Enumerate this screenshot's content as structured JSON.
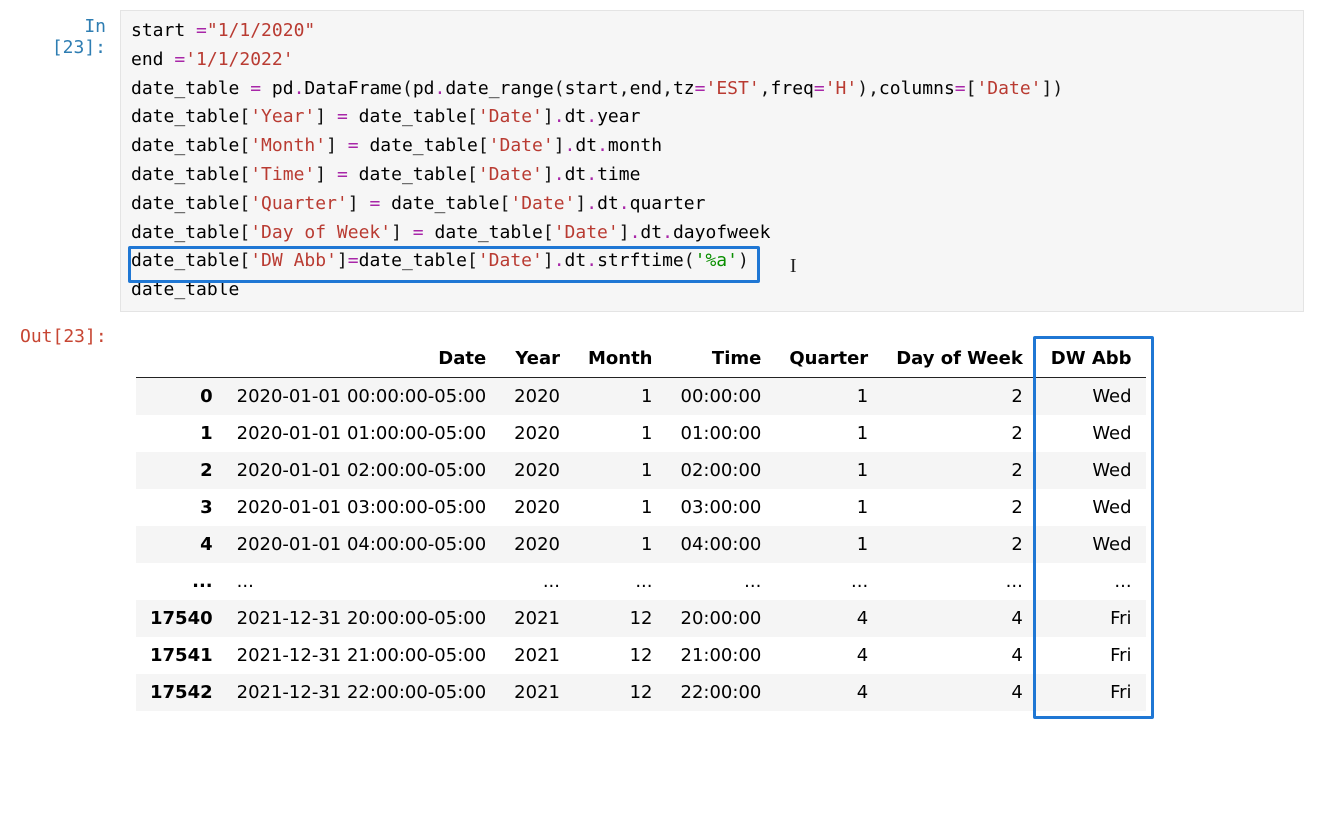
{
  "input_prompt": "In [23]:",
  "output_prompt": "Out[23]:",
  "code_lines": [
    [
      {
        "t": "start ",
        "c": ""
      },
      {
        "t": "=",
        "c": "tok-op"
      },
      {
        "t": "\"1/1/2020\"",
        "c": "tok-str"
      }
    ],
    [
      {
        "t": "end ",
        "c": ""
      },
      {
        "t": "=",
        "c": "tok-op"
      },
      {
        "t": "'1/1/2022'",
        "c": "tok-str"
      }
    ],
    [
      {
        "t": "date_table ",
        "c": ""
      },
      {
        "t": "=",
        "c": "tok-op"
      },
      {
        "t": " pd",
        "c": ""
      },
      {
        "t": ".",
        "c": "tok-op"
      },
      {
        "t": "DataFrame",
        "c": ""
      },
      {
        "t": "(",
        "c": "tok-paren"
      },
      {
        "t": "pd",
        "c": ""
      },
      {
        "t": ".",
        "c": "tok-op"
      },
      {
        "t": "date_range",
        "c": ""
      },
      {
        "t": "(",
        "c": "tok-paren"
      },
      {
        "t": "start",
        "c": ""
      },
      {
        "t": ",",
        "c": "tok-paren"
      },
      {
        "t": "end",
        "c": ""
      },
      {
        "t": ",",
        "c": "tok-paren"
      },
      {
        "t": "tz",
        "c": ""
      },
      {
        "t": "=",
        "c": "tok-op"
      },
      {
        "t": "'EST'",
        "c": "tok-str"
      },
      {
        "t": ",",
        "c": "tok-paren"
      },
      {
        "t": "freq",
        "c": ""
      },
      {
        "t": "=",
        "c": "tok-op"
      },
      {
        "t": "'H'",
        "c": "tok-str"
      },
      {
        "t": ")",
        "c": "tok-paren"
      },
      {
        "t": ",",
        "c": "tok-paren"
      },
      {
        "t": "columns",
        "c": ""
      },
      {
        "t": "=",
        "c": "tok-op"
      },
      {
        "t": "[",
        "c": "tok-paren"
      },
      {
        "t": "'Date'",
        "c": "tok-str"
      },
      {
        "t": "]",
        "c": "tok-paren"
      },
      {
        "t": ")",
        "c": "tok-paren"
      }
    ],
    [
      {
        "t": "date_table",
        "c": ""
      },
      {
        "t": "[",
        "c": "tok-paren"
      },
      {
        "t": "'Year'",
        "c": "tok-str"
      },
      {
        "t": "]",
        "c": "tok-paren"
      },
      {
        "t": " ",
        "c": ""
      },
      {
        "t": "=",
        "c": "tok-op"
      },
      {
        "t": " date_table",
        "c": ""
      },
      {
        "t": "[",
        "c": "tok-paren"
      },
      {
        "t": "'Date'",
        "c": "tok-str"
      },
      {
        "t": "]",
        "c": "tok-paren"
      },
      {
        "t": ".",
        "c": "tok-op"
      },
      {
        "t": "dt",
        "c": ""
      },
      {
        "t": ".",
        "c": "tok-op"
      },
      {
        "t": "year",
        "c": ""
      }
    ],
    [
      {
        "t": "date_table",
        "c": ""
      },
      {
        "t": "[",
        "c": "tok-paren"
      },
      {
        "t": "'Month'",
        "c": "tok-str"
      },
      {
        "t": "]",
        "c": "tok-paren"
      },
      {
        "t": " ",
        "c": ""
      },
      {
        "t": "=",
        "c": "tok-op"
      },
      {
        "t": " date_table",
        "c": ""
      },
      {
        "t": "[",
        "c": "tok-paren"
      },
      {
        "t": "'Date'",
        "c": "tok-str"
      },
      {
        "t": "]",
        "c": "tok-paren"
      },
      {
        "t": ".",
        "c": "tok-op"
      },
      {
        "t": "dt",
        "c": ""
      },
      {
        "t": ".",
        "c": "tok-op"
      },
      {
        "t": "month",
        "c": ""
      }
    ],
    [
      {
        "t": "date_table",
        "c": ""
      },
      {
        "t": "[",
        "c": "tok-paren"
      },
      {
        "t": "'Time'",
        "c": "tok-str"
      },
      {
        "t": "]",
        "c": "tok-paren"
      },
      {
        "t": " ",
        "c": ""
      },
      {
        "t": "=",
        "c": "tok-op"
      },
      {
        "t": " date_table",
        "c": ""
      },
      {
        "t": "[",
        "c": "tok-paren"
      },
      {
        "t": "'Date'",
        "c": "tok-str"
      },
      {
        "t": "]",
        "c": "tok-paren"
      },
      {
        "t": ".",
        "c": "tok-op"
      },
      {
        "t": "dt",
        "c": ""
      },
      {
        "t": ".",
        "c": "tok-op"
      },
      {
        "t": "time",
        "c": ""
      }
    ],
    [
      {
        "t": "date_table",
        "c": ""
      },
      {
        "t": "[",
        "c": "tok-paren"
      },
      {
        "t": "'Quarter'",
        "c": "tok-str"
      },
      {
        "t": "]",
        "c": "tok-paren"
      },
      {
        "t": " ",
        "c": ""
      },
      {
        "t": "=",
        "c": "tok-op"
      },
      {
        "t": " date_table",
        "c": ""
      },
      {
        "t": "[",
        "c": "tok-paren"
      },
      {
        "t": "'Date'",
        "c": "tok-str"
      },
      {
        "t": "]",
        "c": "tok-paren"
      },
      {
        "t": ".",
        "c": "tok-op"
      },
      {
        "t": "dt",
        "c": ""
      },
      {
        "t": ".",
        "c": "tok-op"
      },
      {
        "t": "quarter",
        "c": ""
      }
    ],
    [
      {
        "t": "date_table",
        "c": ""
      },
      {
        "t": "[",
        "c": "tok-paren"
      },
      {
        "t": "'Day of Week'",
        "c": "tok-str"
      },
      {
        "t": "]",
        "c": "tok-paren"
      },
      {
        "t": " ",
        "c": ""
      },
      {
        "t": "=",
        "c": "tok-op"
      },
      {
        "t": " date_table",
        "c": ""
      },
      {
        "t": "[",
        "c": "tok-paren"
      },
      {
        "t": "'Date'",
        "c": "tok-str"
      },
      {
        "t": "]",
        "c": "tok-paren"
      },
      {
        "t": ".",
        "c": "tok-op"
      },
      {
        "t": "dt",
        "c": ""
      },
      {
        "t": ".",
        "c": "tok-op"
      },
      {
        "t": "dayofweek",
        "c": ""
      }
    ],
    [
      {
        "t": "date_table",
        "c": ""
      },
      {
        "t": "[",
        "c": "tok-paren"
      },
      {
        "t": "'DW Abb'",
        "c": "tok-str"
      },
      {
        "t": "]",
        "c": "tok-paren"
      },
      {
        "t": "=",
        "c": "tok-op"
      },
      {
        "t": "date_table",
        "c": ""
      },
      {
        "t": "[",
        "c": "tok-paren"
      },
      {
        "t": "'Date'",
        "c": "tok-str"
      },
      {
        "t": "]",
        "c": "tok-paren"
      },
      {
        "t": ".",
        "c": "tok-op"
      },
      {
        "t": "dt",
        "c": ""
      },
      {
        "t": ".",
        "c": "tok-op"
      },
      {
        "t": "strftime",
        "c": ""
      },
      {
        "t": "(",
        "c": "tok-paren"
      },
      {
        "t": "'%a'",
        "c": "tok-green"
      },
      {
        "t": ")",
        "c": "tok-paren"
      }
    ],
    [
      {
        "t": "date_table",
        "c": ""
      }
    ]
  ],
  "table": {
    "columns": [
      "Date",
      "Year",
      "Month",
      "Time",
      "Quarter",
      "Day of Week",
      "DW Abb"
    ],
    "rows": [
      {
        "idx": "0",
        "cells": [
          "2020-01-01 00:00:00-05:00",
          "2020",
          "1",
          "00:00:00",
          "1",
          "2",
          "Wed"
        ]
      },
      {
        "idx": "1",
        "cells": [
          "2020-01-01 01:00:00-05:00",
          "2020",
          "1",
          "01:00:00",
          "1",
          "2",
          "Wed"
        ]
      },
      {
        "idx": "2",
        "cells": [
          "2020-01-01 02:00:00-05:00",
          "2020",
          "1",
          "02:00:00",
          "1",
          "2",
          "Wed"
        ]
      },
      {
        "idx": "3",
        "cells": [
          "2020-01-01 03:00:00-05:00",
          "2020",
          "1",
          "03:00:00",
          "1",
          "2",
          "Wed"
        ]
      },
      {
        "idx": "4",
        "cells": [
          "2020-01-01 04:00:00-05:00",
          "2020",
          "1",
          "04:00:00",
          "1",
          "2",
          "Wed"
        ]
      },
      {
        "idx": "...",
        "cells": [
          "...",
          "...",
          "...",
          "...",
          "...",
          "...",
          "..."
        ]
      },
      {
        "idx": "17540",
        "cells": [
          "2021-12-31 20:00:00-05:00",
          "2021",
          "12",
          "20:00:00",
          "4",
          "4",
          "Fri"
        ]
      },
      {
        "idx": "17541",
        "cells": [
          "2021-12-31 21:00:00-05:00",
          "2021",
          "12",
          "21:00:00",
          "4",
          "4",
          "Fri"
        ]
      },
      {
        "idx": "17542",
        "cells": [
          "2021-12-31 22:00:00-05:00",
          "2021",
          "12",
          "22:00:00",
          "4",
          "4",
          "Fri"
        ]
      }
    ]
  },
  "cursor_char": "I"
}
